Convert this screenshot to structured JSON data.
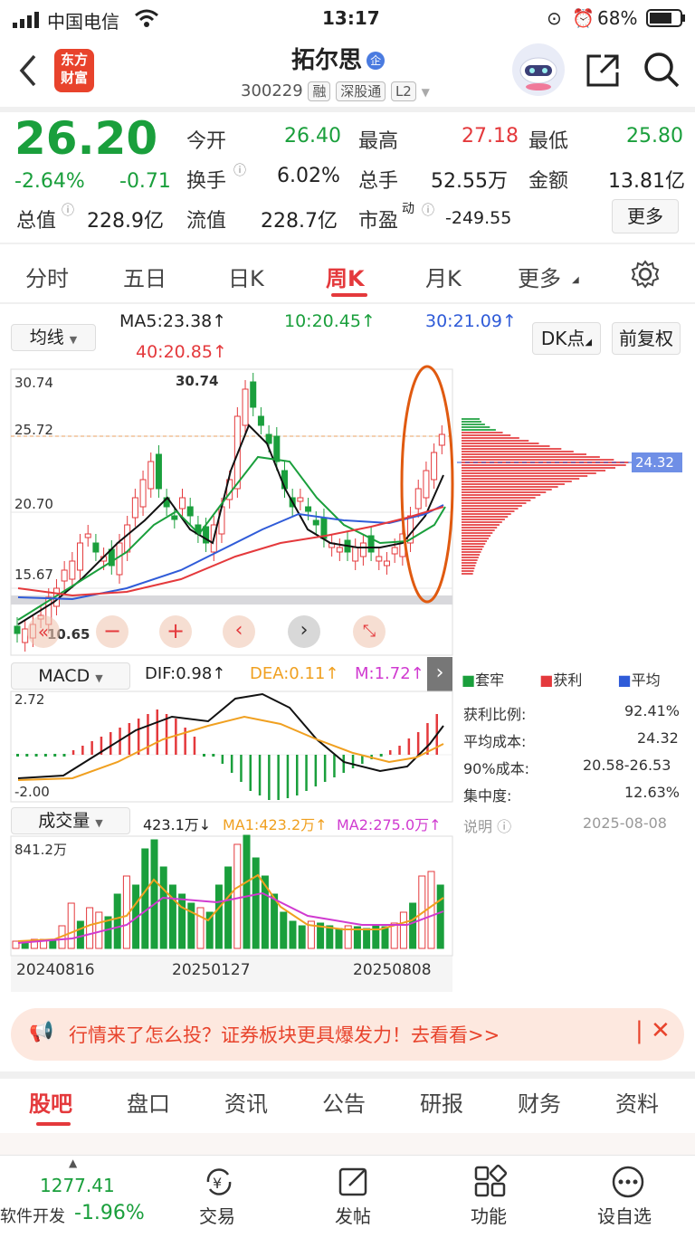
{
  "status": {
    "carrier": "中国电信",
    "time": "13:17",
    "battery": "68%"
  },
  "header": {
    "logo_line1": "东方",
    "logo_line2": "财富",
    "title": "拓尔思",
    "badge": "企",
    "code": "300229",
    "tags": [
      "融",
      "深股通",
      "L2"
    ]
  },
  "quote": {
    "price": "26.20",
    "change_pct": "-2.64%",
    "change": "-0.71",
    "rows": [
      [
        {
          "l": "今开",
          "v": "26.40",
          "c": "green"
        },
        {
          "l": "最高",
          "v": "27.18",
          "c": "red"
        },
        {
          "l": "最低",
          "v": "25.80",
          "c": "green"
        }
      ],
      [
        {
          "l": "换手",
          "v": "6.02%",
          "c": "dark"
        },
        {
          "l": "总手",
          "v": "52.55万",
          "c": "dark"
        },
        {
          "l": "金额",
          "v": "13.81亿",
          "c": "dark"
        }
      ]
    ],
    "total_value_label": "总值",
    "total_value": "228.9亿",
    "float_label": "流值",
    "float_value": "228.7亿",
    "pe_label": "市盈",
    "pe_sup": "动",
    "pe_value": "-249.55",
    "more": "更多"
  },
  "tabs": [
    "分时",
    "五日",
    "日K",
    "周K",
    "月K",
    "更多"
  ],
  "active_tab": "周K",
  "ma_bar": {
    "select": "均线",
    "ma5": "MA5:23.38↑",
    "ma10": "10:20.45↑",
    "ma30": "30:21.09↑",
    "ma40": "40:20.85↑",
    "dk": "DK点",
    "fq": "前复权"
  },
  "price_axis": {
    "top": "30.74",
    "l2": "25.72",
    "l3": "20.70",
    "l4": "15.67",
    "low": "10.65",
    "high_mark": "30.74",
    "cost_tag": "24.32"
  },
  "macd": {
    "select": "MACD",
    "dif": "DIF:0.98↑",
    "dea": "DEA:0.11↑",
    "m": "M:1.72↑",
    "top": "2.72",
    "bottom": "-2.00"
  },
  "volume": {
    "select": "成交量",
    "val": "423.1万↓",
    "ma1": "MA1:423.2万↑",
    "ma2": "MA2:275.0万↑",
    "top": "841.2万"
  },
  "dates": [
    "20240816",
    "20250127",
    "20250808"
  ],
  "chip": {
    "legend": [
      "套牢",
      "获利",
      "平均"
    ],
    "rows": [
      {
        "l": "获利比例:",
        "v": "92.41%"
      },
      {
        "l": "平均成本:",
        "v": "24.32"
      },
      {
        "l": "90%成本:",
        "v": "20.58-26.53"
      },
      {
        "l": "集中度:",
        "v": "12.63%"
      }
    ],
    "note_label": "说明",
    "date": "2025-08-08"
  },
  "banner": {
    "text": "行情来了怎么投？证券板块更具爆发力！去看看>>"
  },
  "sub_tabs": [
    "股吧",
    "盘口",
    "资讯",
    "公告",
    "研报",
    "财务",
    "资料"
  ],
  "bottom": {
    "index_value": "1277.41",
    "index_name": "软件开发",
    "index_change": "-1.96%",
    "items": [
      "交易",
      "发帖",
      "功能",
      "设自选"
    ]
  },
  "colors": {
    "up": "#e4393c",
    "down": "#1a9f3c",
    "accent": "#e4393c",
    "annotation": "#e05a10"
  }
}
